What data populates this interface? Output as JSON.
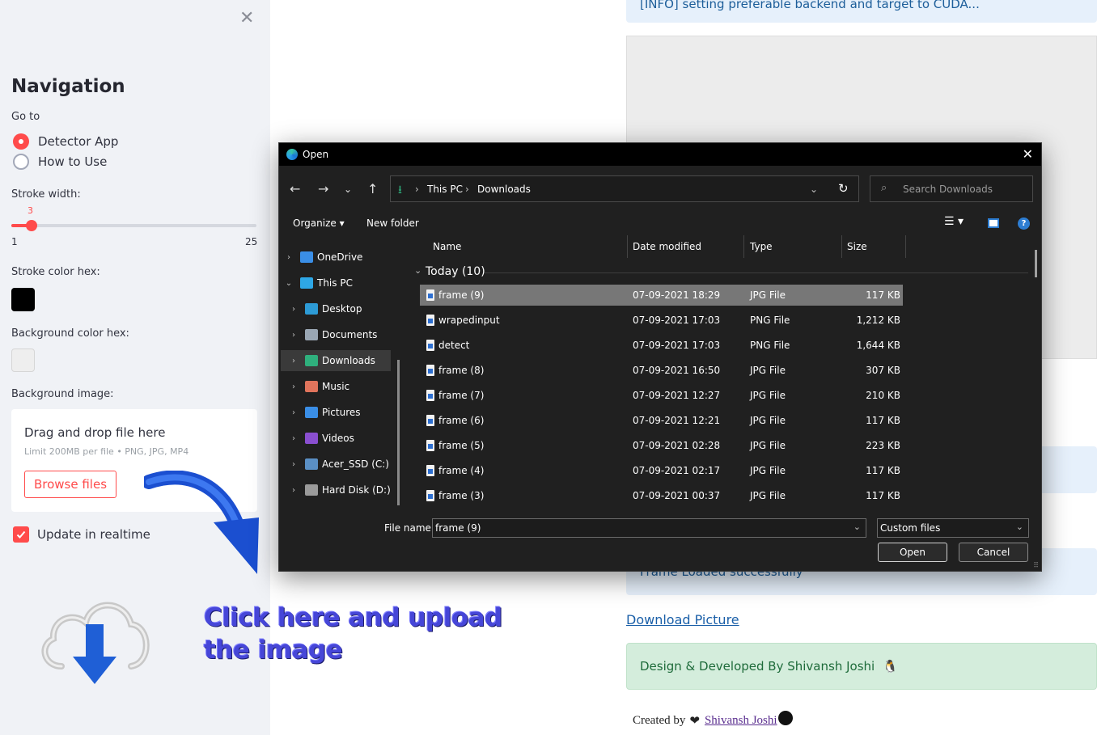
{
  "sidebar": {
    "title": "Navigation",
    "goto_label": "Go to",
    "radio_options": [
      "Detector App",
      "How to Use"
    ],
    "selected_option": "Detector App",
    "stroke_width_label": "Stroke width:",
    "stroke_width_value": "3",
    "stroke_width_min": "1",
    "stroke_width_max": "25",
    "stroke_color_label": "Stroke color hex:",
    "stroke_color": "#000000",
    "bg_color_label": "Background color hex:",
    "bg_color": "#eeeeee",
    "bg_image_label": "Background image:",
    "uploader": {
      "title": "Drag and drop file here",
      "subtitle": "Limit 200MB per file • PNG, JPG, MP4",
      "button": "Browse files"
    },
    "realtime_label": "Update in realtime",
    "realtime_checked": true
  },
  "main": {
    "info_top": "[INFO] setting preferable backend and target to CUDA...",
    "info_frame": "Frame Loaded successfully",
    "download_link": "Download Picture",
    "footer_success": "Design & Developed By Shivansh Joshi",
    "created_by_prefix": "Created by",
    "created_by_name": "Shivansh Joshi"
  },
  "annotation": "Click here and upload the image",
  "dialog": {
    "title": "Open",
    "breadcrumb": [
      "This PC",
      "Downloads"
    ],
    "search_placeholder": "Search Downloads",
    "toolbar": {
      "organize": "Organize",
      "new_folder": "New folder"
    },
    "nav_pane": [
      {
        "label": "OneDrive",
        "icon": "onedrive-icon",
        "color": "#3a8ee6",
        "indent": 0,
        "expanded": false
      },
      {
        "label": "This PC",
        "icon": "pc-icon",
        "color": "#2ea7e6",
        "indent": 0,
        "expanded": true
      },
      {
        "label": "Desktop",
        "icon": "desktop-icon",
        "color": "#2d9bd6",
        "indent": 1,
        "expanded": false
      },
      {
        "label": "Documents",
        "icon": "documents-icon",
        "color": "#9aa7b4",
        "indent": 1,
        "expanded": false
      },
      {
        "label": "Downloads",
        "icon": "downloads-icon",
        "color": "#2fb07d",
        "indent": 1,
        "expanded": false,
        "selected": true
      },
      {
        "label": "Music",
        "icon": "music-icon",
        "color": "#e0745c",
        "indent": 1,
        "expanded": false
      },
      {
        "label": "Pictures",
        "icon": "pictures-icon",
        "color": "#3a8ee6",
        "indent": 1,
        "expanded": false
      },
      {
        "label": "Videos",
        "icon": "videos-icon",
        "color": "#8a4fd0",
        "indent": 1,
        "expanded": false
      },
      {
        "label": "Acer_SSD (C:)",
        "icon": "drive-icon",
        "color": "#5a8fc4",
        "indent": 1,
        "expanded": false
      },
      {
        "label": "Hard Disk (D:)",
        "icon": "drive-icon",
        "color": "#9a9a9a",
        "indent": 1,
        "expanded": false
      }
    ],
    "columns": [
      "Name",
      "Date modified",
      "Type",
      "Size"
    ],
    "group": "Today (10)",
    "files": [
      {
        "name": "frame (9)",
        "date": "07-09-2021 18:29",
        "type": "JPG File",
        "size": "117 KB",
        "selected": true
      },
      {
        "name": "wrapedinput",
        "date": "07-09-2021 17:03",
        "type": "PNG File",
        "size": "1,212 KB"
      },
      {
        "name": "detect",
        "date": "07-09-2021 17:03",
        "type": "PNG File",
        "size": "1,644 KB"
      },
      {
        "name": "frame (8)",
        "date": "07-09-2021 16:50",
        "type": "JPG File",
        "size": "307 KB"
      },
      {
        "name": "frame (7)",
        "date": "07-09-2021 12:27",
        "type": "JPG File",
        "size": "210 KB"
      },
      {
        "name": "frame (6)",
        "date": "07-09-2021 12:21",
        "type": "JPG File",
        "size": "117 KB"
      },
      {
        "name": "frame (5)",
        "date": "07-09-2021 02:28",
        "type": "JPG File",
        "size": "223 KB"
      },
      {
        "name": "frame (4)",
        "date": "07-09-2021 02:17",
        "type": "JPG File",
        "size": "117 KB"
      },
      {
        "name": "frame (3)",
        "date": "07-09-2021 00:37",
        "type": "JPG File",
        "size": "117 KB"
      }
    ],
    "file_name_label": "File name:",
    "file_name_value": "frame (9)",
    "file_type": "Custom files",
    "open_button": "Open",
    "cancel_button": "Cancel"
  }
}
